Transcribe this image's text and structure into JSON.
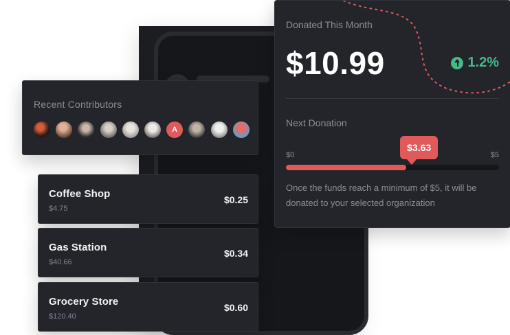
{
  "recent_contributors": {
    "title": "Recent Contributors",
    "avatars": [
      "",
      "",
      "",
      "",
      "",
      "",
      "A",
      "",
      "",
      ""
    ]
  },
  "transactions": [
    {
      "name": "Coffee Shop",
      "total": "$4.75",
      "roundup": "$0.25"
    },
    {
      "name": "Gas Station",
      "total": "$40.66",
      "roundup": "$0.34"
    },
    {
      "name": "Grocery Store",
      "total": "$120.40",
      "roundup": "$0.60"
    }
  ],
  "donation": {
    "title": "Donated This Month",
    "amount": "$10.99",
    "change": "1.2%",
    "next_title": "Next Donation",
    "min_label": "$0",
    "max_label": "$5",
    "current_label": "$3.63",
    "progress_fraction": 0.565,
    "description": "Once the funds reach a minimum of $5, it will be donated to your selected organization"
  },
  "colors": {
    "accent": "#e05a5a",
    "success": "#47b98a"
  },
  "icons": {
    "change_icon": "arrow-up-circle-icon"
  }
}
